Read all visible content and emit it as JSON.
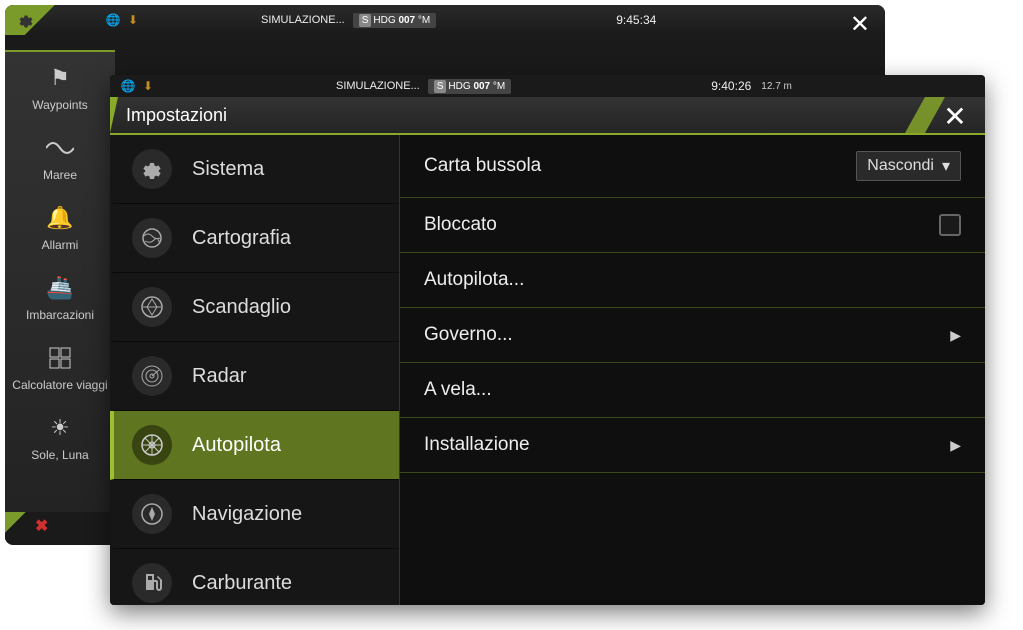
{
  "back": {
    "simulation": "SIMULAZIONE...",
    "hdg_prefix": "S",
    "hdg_label": "HDG",
    "hdg_value": "007",
    "hdg_unit": "°M",
    "time": "9:45:34"
  },
  "sidebar_tools": [
    {
      "label": "Waypoints",
      "icon": "flag"
    },
    {
      "label": "Maree",
      "icon": "wave"
    },
    {
      "label": "Allarmi",
      "icon": "bell"
    },
    {
      "label": "Imbarcazioni",
      "icon": "ship"
    },
    {
      "label": "Calcolatore viaggi",
      "icon": "calc"
    },
    {
      "label": "Sole, Luna",
      "icon": "sun"
    }
  ],
  "front": {
    "simulation": "SIMULAZIONE...",
    "hdg_prefix": "S",
    "hdg_label": "HDG",
    "hdg_value": "007",
    "hdg_unit": "°M",
    "time": "9:40:26",
    "depth": "12.7 m",
    "title": "Impostazioni"
  },
  "categories": [
    {
      "label": "Sistema",
      "icon": "gear",
      "selected": false
    },
    {
      "label": "Cartografia",
      "icon": "map",
      "selected": false
    },
    {
      "label": "Scandaglio",
      "icon": "sonar",
      "selected": false
    },
    {
      "label": "Radar",
      "icon": "radar",
      "selected": false
    },
    {
      "label": "Autopilota",
      "icon": "wheel",
      "selected": true
    },
    {
      "label": "Navigazione",
      "icon": "compass",
      "selected": false
    },
    {
      "label": "Carburante",
      "icon": "fuel",
      "selected": false
    }
  ],
  "options": [
    {
      "label": "Carta bussola",
      "type": "dropdown",
      "value": "Nascondi"
    },
    {
      "label": "Bloccato",
      "type": "checkbox",
      "checked": false
    },
    {
      "label": "Autopilota...",
      "type": "link"
    },
    {
      "label": "Governo...",
      "type": "submenu"
    },
    {
      "label": "A vela...",
      "type": "link"
    },
    {
      "label": "Installazione",
      "type": "submenu"
    }
  ]
}
